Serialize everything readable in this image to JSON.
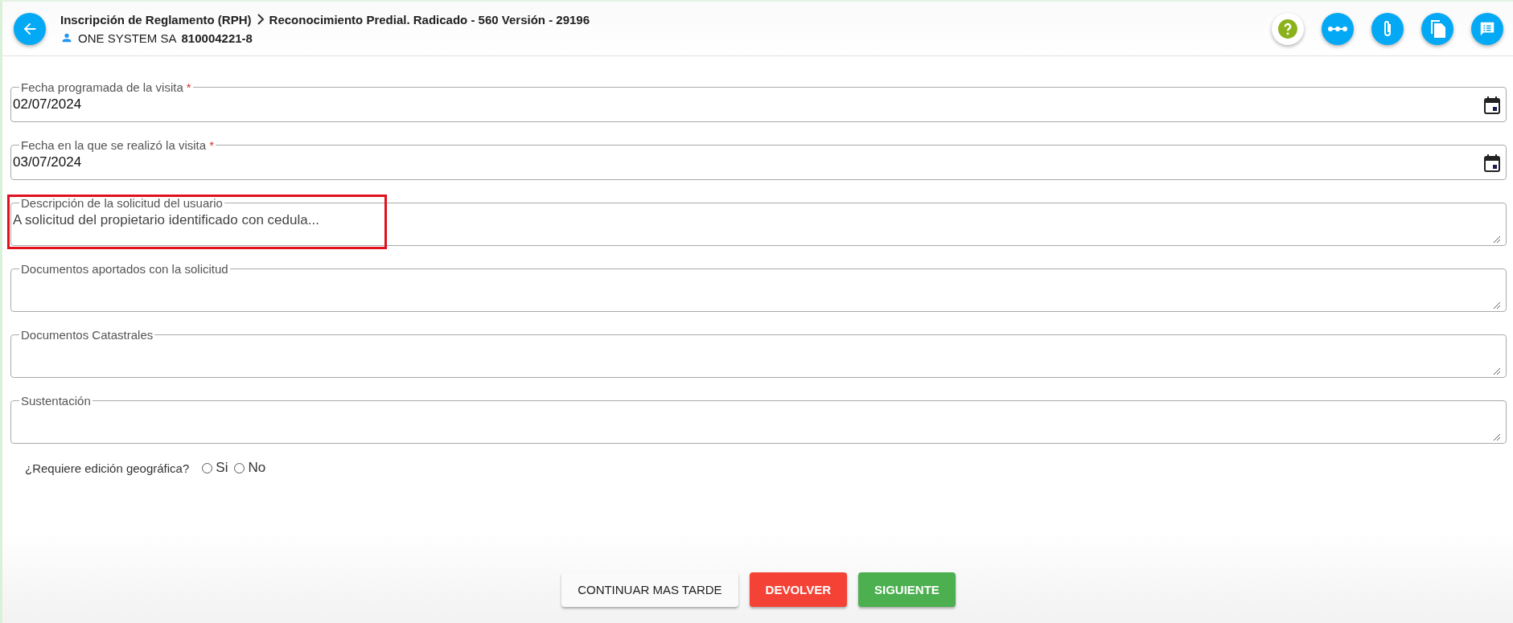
{
  "header": {
    "breadcrumb": [
      "Inscripción de Reglamento (RPH)",
      "Reconocimiento Predial. Radicado - 560 Versión - 29196"
    ],
    "company": "ONE SYSTEM SA",
    "company_id": "810004221-8"
  },
  "fields": [
    {
      "kind": "date",
      "label": "Fecha programada de la visita",
      "required_mark": "*",
      "value": "02/07/2024"
    },
    {
      "kind": "date",
      "label": "Fecha en la que se realizó la visita",
      "required_mark": "*",
      "value": "03/07/2024"
    },
    {
      "kind": "textarea",
      "label": "Descripción de la solicitud del usuario",
      "value": "A solicitud del propietario identificado con cedula...",
      "highlighted": true
    },
    {
      "kind": "textarea",
      "label": "Documentos aportados con la solicitud"
    },
    {
      "kind": "textarea",
      "label": "Documentos Catastrales"
    },
    {
      "kind": "textarea",
      "label": "Sustentación"
    }
  ],
  "question": {
    "label": "¿Requiere edición geográfica?",
    "options": [
      {
        "label": "Si",
        "selected": false
      },
      {
        "label": "No",
        "selected": false
      }
    ]
  },
  "buttons": [
    {
      "label": "CONTINUAR MAS TARDE",
      "kind": "default"
    },
    {
      "label": "DEVOLVER",
      "kind": "danger"
    },
    {
      "label": "SIGUIENTE",
      "kind": "success"
    }
  ]
}
